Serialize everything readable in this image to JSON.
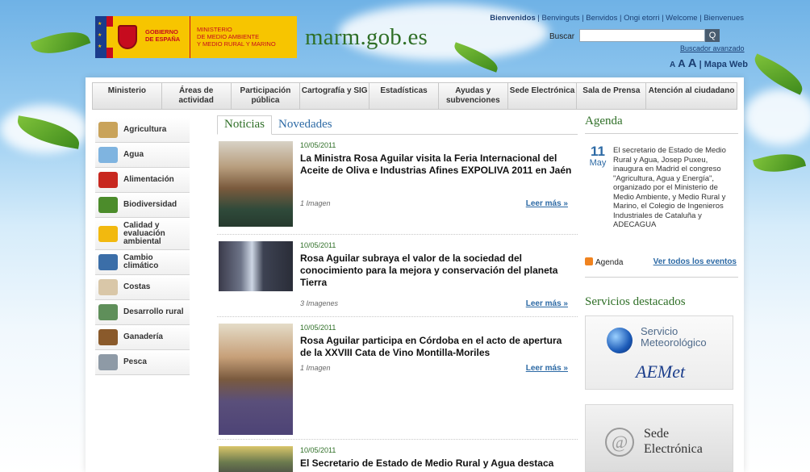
{
  "header": {
    "gov_line1": "GOBIERNO",
    "gov_line2": "DE ESPAÑA",
    "ministry_line1": "MINISTERIO",
    "ministry_line2": "DE MEDIO AMBIENTE",
    "ministry_line3": "Y MEDIO RURAL Y MARINO",
    "site_title": "marm.gob.es",
    "welcome_bold": "Bienvenidos",
    "welcome_rest": " | Benvinguts | Benvidos | Ongi etorri | Welcome | Bienvenues",
    "search_label": "Buscar",
    "search_value": "",
    "search_button": "Q",
    "advanced_search": "Buscador avanzado",
    "font_a1": "A",
    "font_a2": "A",
    "font_a3": "A",
    "sitemap": "| Mapa Web"
  },
  "topnav": [
    "Ministerio",
    "Áreas de actividad",
    "Participación pública",
    "Cartografía y SIG",
    "Estadísticas",
    "Ayudas y subvenciones",
    "Sede Electrónica",
    "Sala de Prensa",
    "Atención al ciudadano"
  ],
  "sidebar": [
    {
      "label": "Agricultura",
      "icon": "wheat-icon",
      "color": "#c9a35a"
    },
    {
      "label": "Agua",
      "icon": "water-icon",
      "color": "#7fb4e0"
    },
    {
      "label": "Alimentación",
      "icon": "apple-icon",
      "color": "#c8281f"
    },
    {
      "label": "Biodiversidad",
      "icon": "tree-icon",
      "color": "#4c8c2b"
    },
    {
      "label": "Calidad y evaluación ambiental",
      "icon": "sunflower-icon",
      "color": "#f2b90f"
    },
    {
      "label": "Cambio climático",
      "icon": "earth-icon",
      "color": "#3b6ea8"
    },
    {
      "label": "Costas",
      "icon": "shell-icon",
      "color": "#d9c7a8"
    },
    {
      "label": "Desarrollo rural",
      "icon": "landscape-icon",
      "color": "#5f8f5a"
    },
    {
      "label": "Ganadería",
      "icon": "cow-icon",
      "color": "#8a5a2b"
    },
    {
      "label": "Pesca",
      "icon": "fish-icon",
      "color": "#8e9aa6"
    }
  ],
  "news": {
    "tab_active": "Noticias",
    "tab_other": "Novedades",
    "items": [
      {
        "date": "10/05/2011",
        "title": "La Ministra Rosa Aguilar visita la Feria Internacional del Aceite de Oliva e Industrias Afines EXPOLIVA 2011 en Jaén",
        "meta": "1 Imagen",
        "more": "Leer más »"
      },
      {
        "date": "10/05/2011",
        "title": "Rosa Aguilar subraya el valor de la sociedad del conocimiento para la mejora y conservación del planeta Tierra",
        "meta": "3 Imagenes",
        "more": "Leer más »"
      },
      {
        "date": "10/05/2011",
        "title": "Rosa Aguilar participa en Córdoba en el acto de apertura de la XXVIII Cata de Vino Montilla-Moriles",
        "meta": "1 Imagen",
        "more": "Leer más »"
      },
      {
        "date": "10/05/2011",
        "title": "El Secretario de Estado de Medio Rural y Agua destaca",
        "meta": "",
        "more": ""
      }
    ]
  },
  "agenda": {
    "title": "Agenda",
    "day": "11",
    "month": "May",
    "text": "El secretario de Estado de Medio Rural y Agua, Josep Puxeu, inaugura en Madrid el congreso \"Agricultura, Agua y Energía\", organizado por el Ministerio de Medio Ambiente, y Medio Rural y Marino, el Colegio de Ingenieros Industriales de Cataluña y ADECAGUA",
    "rss_label": "Agenda",
    "all_events": "Ver todos los eventos"
  },
  "services": {
    "title": "Servicios destacados",
    "meteo_line1": "Servicio",
    "meteo_line2": "Meteorológico",
    "aemet": "AEMet",
    "sede_line1": "Sede",
    "sede_line2": "Electrónica"
  }
}
